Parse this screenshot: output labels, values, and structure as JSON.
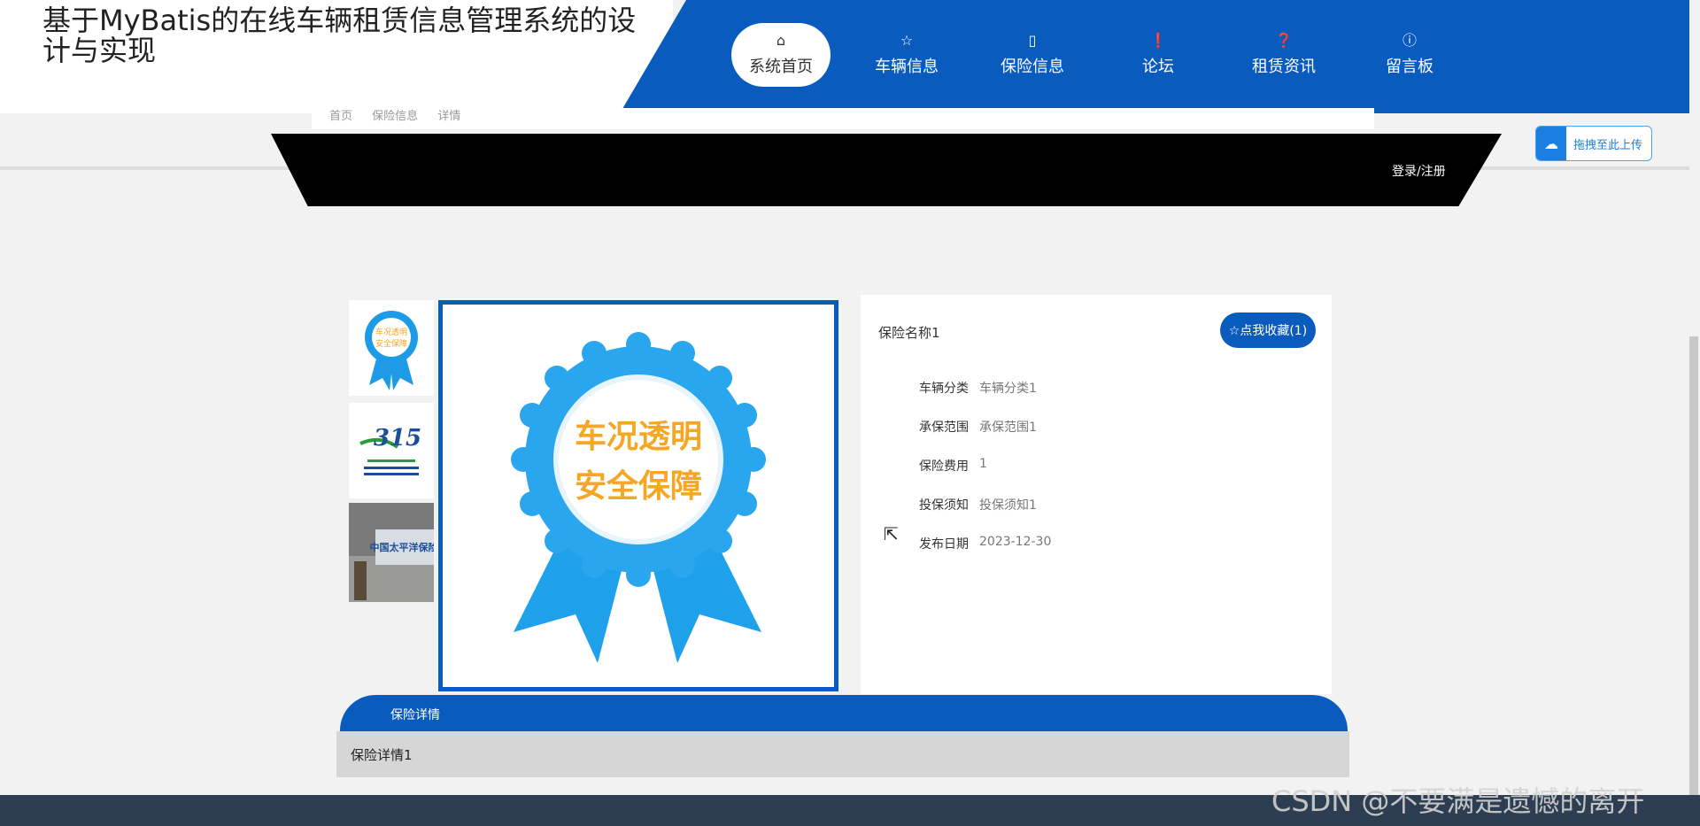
{
  "header": {
    "site_title": "基于MyBatis的在线车辆租赁信息管理系统的设计与实现",
    "nav": [
      {
        "label": "系统首页",
        "icon": "home-icon",
        "glyph": "⌂",
        "active": true
      },
      {
        "label": "车辆信息",
        "icon": "star-icon",
        "glyph": "☆",
        "active": false
      },
      {
        "label": "保险信息",
        "icon": "bag-icon",
        "glyph": "▯",
        "active": false
      },
      {
        "label": "论坛",
        "icon": "alert-icon",
        "glyph": "❗",
        "active": false
      },
      {
        "label": "租赁资讯",
        "icon": "question-icon",
        "glyph": "❓",
        "active": false
      },
      {
        "label": "留言板",
        "icon": "info-icon",
        "glyph": "ⓘ",
        "active": false
      }
    ],
    "breadcrumb": [
      "首页",
      "保险信息",
      "详情"
    ],
    "login_label": "登录/注册",
    "upload_label": "拖拽至此上传"
  },
  "gallery": {
    "badge_line1": "车况透明",
    "badge_line2": "安全保障",
    "thumb2_text": "315",
    "thumb3_text": "中国太平洋保险"
  },
  "info": {
    "name": "保险名称1",
    "fav_label": "☆点我收藏(1)",
    "fields": [
      {
        "label": "车辆分类",
        "value": "车辆分类1"
      },
      {
        "label": "承保范围",
        "value": "承保范围1"
      },
      {
        "label": "保险费用",
        "value": "1"
      },
      {
        "label": "投保须知",
        "value": "投保须知1"
      },
      {
        "label": "发布日期",
        "value": "2023-12-30"
      }
    ]
  },
  "detail": {
    "tab_label": "保险详情",
    "content": "保险详情1"
  },
  "watermark": "CSDN @不要满是遗憾的离开",
  "colors": {
    "primary": "#0a5bbe",
    "badge_blue": "#1e9be6",
    "badge_text": "#f5a623"
  }
}
